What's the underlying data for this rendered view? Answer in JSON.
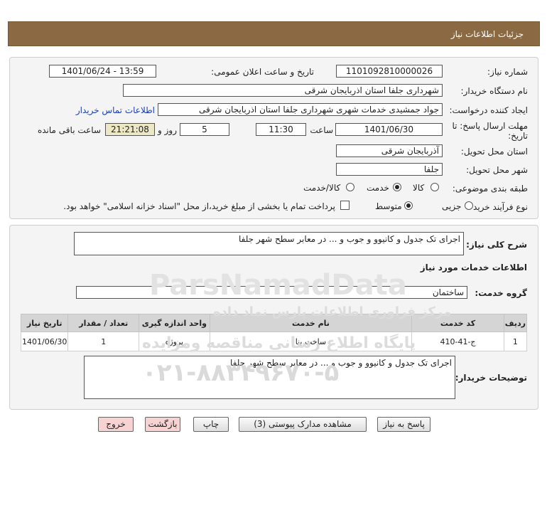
{
  "header": {
    "title": "جزئیات اطلاعات نیاز"
  },
  "info": {
    "need_number_label": "شماره نیاز:",
    "need_number": "1101092810000026",
    "announce_label": "تاریخ و ساعت اعلان عمومی:",
    "announce_value": "1401/06/24 - 13:59",
    "buyer_label": "نام دستگاه خریدار:",
    "buyer_value": "شهرداری جلفا استان اذربایجان شرقی",
    "creator_label": "ایجاد کننده درخواست:",
    "creator_value": "جواد جمشیدی  خدمات شهری شهرداری جلفا استان اذربایجان شرقی",
    "contact_link": "اطلاعات تماس خریدار",
    "deadline_label_1": "مهلت ارسال پاسخ: تا",
    "deadline_label_2": "تاریخ:",
    "deadline_date": "1401/06/30",
    "time_label": "ساعت",
    "deadline_time": "11:30",
    "days_value": "5",
    "days_label": "روز و",
    "remaining_time": "21:21:08",
    "remaining_label": "ساعت باقی مانده",
    "province_label": "استان محل تحویل:",
    "province_value": "آذربایجان شرقی",
    "city_label": "شهر محل تحویل:",
    "city_value": "جلفا",
    "category_label": "طبقه بندی موضوعی:",
    "category_options": [
      "کالا",
      "خدمت",
      "کالا/خدمت"
    ],
    "category_selected": "خدمت",
    "process_label": "نوع فرآیند خرید :",
    "process_options": [
      "جزیی",
      "متوسط"
    ],
    "process_selected": "متوسط",
    "treasury_note": "پرداخت تمام یا بخشی از مبلغ خرید،از محل \"اسناد خزانه اسلامی\" خواهد بود."
  },
  "summary": {
    "desc_label": "شرح کلی نیاز:",
    "desc_value": "اجرای تک جدول و کانیوو و جوب و ... در معابر سطح شهر جلفا",
    "services_heading": "اطلاعات خدمات مورد نیاز",
    "service_group_label": "گروه خدمت:",
    "service_group_value": "ساختمان",
    "table_headers": [
      "ردیف",
      "کد خدمت",
      "نام خدمت",
      "واحد اندازه گیری",
      "تعداد / مقدار",
      "تاریخ نیاز"
    ],
    "rows": [
      [
        "1",
        "ج-41-410",
        "ساخت بنا",
        "پروژه",
        "1",
        "1401/06/30"
      ]
    ],
    "buyer_notes_label": "توضیحات خریدار:",
    "buyer_notes_value": "اجرای تک جدول و کانیوو و جوب و ... در معابر سطح شهر جلفا"
  },
  "buttons": {
    "reply": "پاسخ به نیاز",
    "attachments": "مشاهده مدارک پیوستی (3)",
    "print": "چاپ",
    "back": "بازگشت",
    "exit": "خروج"
  },
  "watermark": {
    "line1": "ParsNamadData",
    "line2": "مرکز فراوری اطلاعات پارس نماد داده",
    "line3": "پایگاه اطلاع رسانی مناقصه ومزایده",
    "line4": "۰۲۱-۸۸۳۴۹۶۷۰-۵"
  }
}
